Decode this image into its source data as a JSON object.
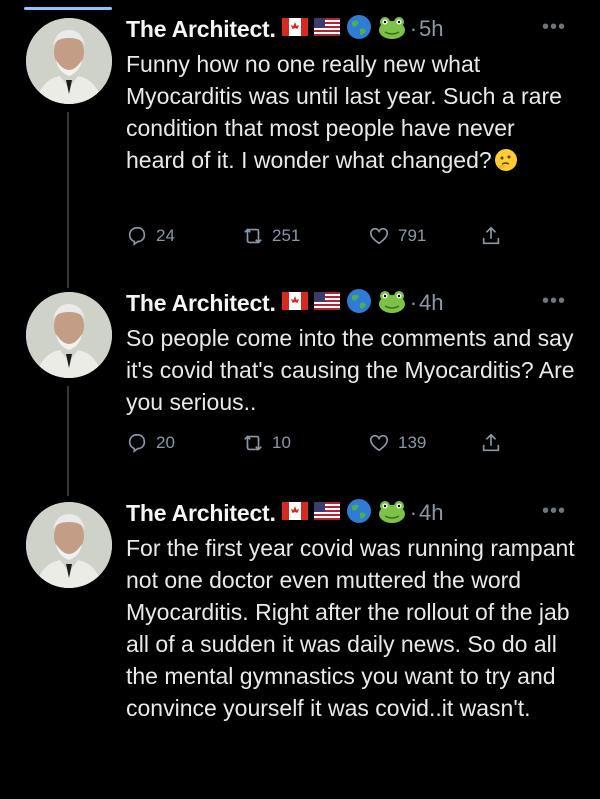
{
  "author": {
    "name": "The Architect."
  },
  "tweets": [
    {
      "time": "5h",
      "text": "Funny how no one really new what Myocarditis was until last year. Such a rare condition that most people have never heard of it. I wonder what changed?",
      "replies": "24",
      "retweets": "251",
      "likes": "791"
    },
    {
      "time": "4h",
      "text": "So people come into the comments and say it's covid that's causing the Myocarditis? Are you serious..",
      "replies": "20",
      "retweets": "10",
      "likes": "139"
    },
    {
      "time": "4h",
      "text": "For the first year covid was running rampant not one doctor even muttered the word Myocarditis. Right after the rollout of the jab all of a sudden it was daily news. So do all the mental gymnastics you want to try and convince yourself it was covid..it wasn't."
    }
  ],
  "icons": {
    "flags": [
      "canada-flag-icon",
      "usa-flag-icon"
    ],
    "emoji": [
      "globe-icon",
      "frog-icon",
      "thinking-face-icon"
    ],
    "actions": [
      "reply-icon",
      "retweet-icon",
      "like-icon",
      "share-icon"
    ]
  },
  "colors": {
    "background": "#000000",
    "text": "#e7e9ea",
    "muted": "#8b98a5",
    "accent": "#1d9bf0"
  }
}
